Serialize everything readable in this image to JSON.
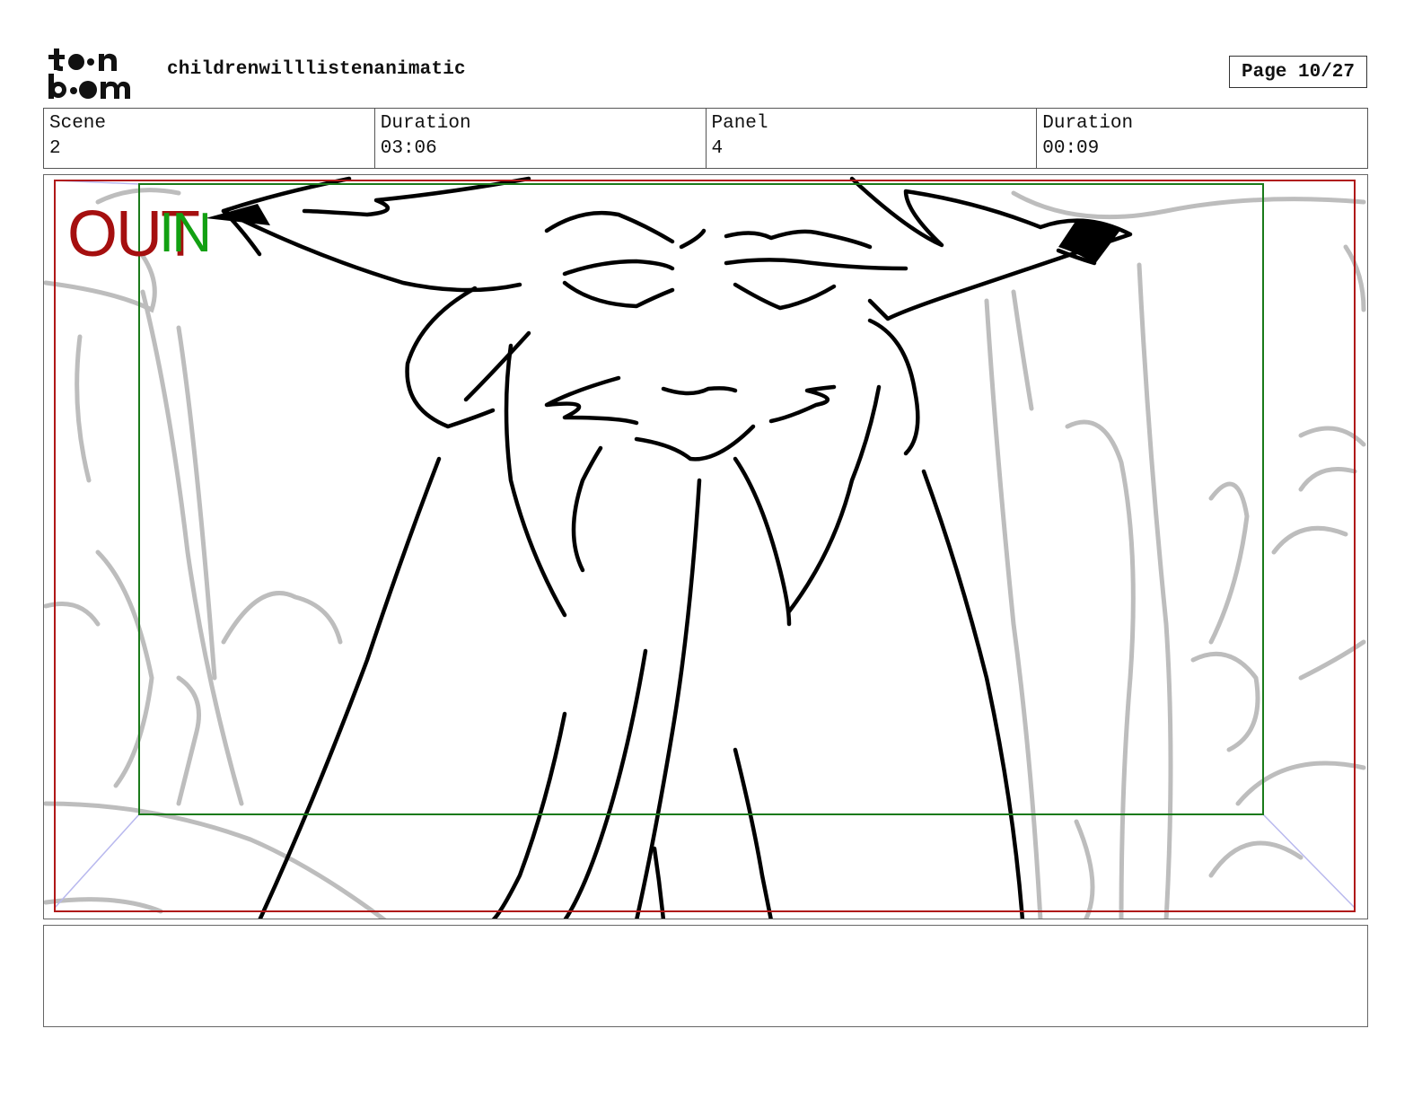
{
  "header": {
    "logo": "toon boom",
    "title": "childrenwilllistenanimatic",
    "page": "Page 10/27"
  },
  "info": {
    "scene_label": "Scene",
    "scene_value": "2",
    "scene_duration_label": "Duration",
    "scene_duration_value": "03:06",
    "panel_label": "Panel",
    "panel_value": "4",
    "panel_duration_label": "Duration",
    "panel_duration_value": "00:09"
  },
  "panel": {
    "out_label": "OUT",
    "in_label": "IN",
    "out_frame_color": "#b01818",
    "in_frame_color": "#1a7a1a",
    "sketch_color": "#000000",
    "background_sketch_color": "#bdbdbd"
  },
  "notes": {
    "text": ""
  }
}
